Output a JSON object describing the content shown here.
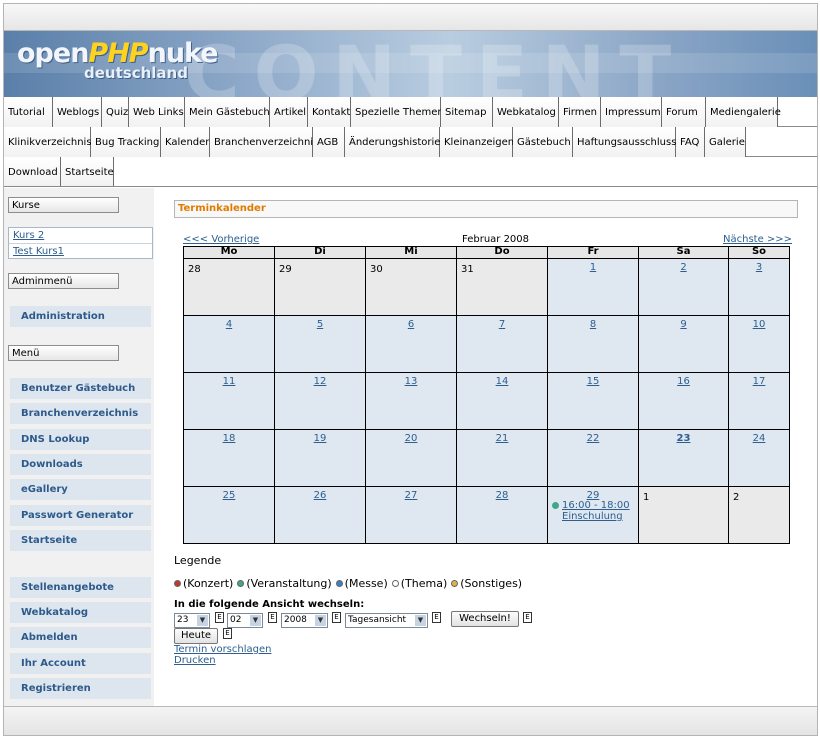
{
  "logo": {
    "part1": "open",
    "part2": "PHP",
    "part3": "nuke",
    "subtitle": "deutschland",
    "watermark": "CONTENT"
  },
  "nav": {
    "row1": [
      "Tutorial",
      "Weblogs",
      "Quiz",
      "Web Links",
      "Mein Gästebuch",
      "Artikel",
      "Kontakt",
      "Spezielle Themen",
      "Sitemap",
      "Webkatalog",
      "Firmen",
      "Impressum",
      "Forum",
      "Mediengalerie"
    ],
    "row2": [
      "Klinikverzeichnis",
      "Bug Tracking",
      "Kalender",
      "Branchenverzeichnis",
      "AGB",
      "Änderungshistorie",
      "Kleinanzeigen",
      "Gästebuch",
      "Haftungsausschluss",
      "FAQ",
      "Galerie"
    ],
    "row3": [
      "Download",
      "Startseite"
    ]
  },
  "sidebar": {
    "kurse_title": "Kurse",
    "kurse": [
      "Kurs 2",
      "Test Kurs1"
    ],
    "admin_title": "Adminmenü",
    "admin_links": [
      "Administration"
    ],
    "menu_title": "Menü",
    "menu_links": [
      "Benutzer Gästebuch",
      "Branchenverzeichnis",
      "DNS Lookup",
      "Downloads",
      "eGallery",
      "Passwort Generator",
      "Startseite"
    ],
    "menu_links2": [
      "Stellenangebote",
      "Webkatalog",
      "Abmelden",
      "Ihr Account",
      "Registrieren"
    ]
  },
  "calendar": {
    "title": "Terminkalender",
    "prev": "<<< Vorherige",
    "month": "Februar 2008",
    "next": "Nächste >>>",
    "weekdays": [
      "Mo",
      "Di",
      "Mi",
      "Do",
      "Fr",
      "Sa",
      "So"
    ],
    "weeks": [
      [
        {
          "d": "28",
          "other": true
        },
        {
          "d": "29",
          "other": true
        },
        {
          "d": "30",
          "other": true
        },
        {
          "d": "31",
          "other": true
        },
        {
          "d": "1"
        },
        {
          "d": "2"
        },
        {
          "d": "3"
        }
      ],
      [
        {
          "d": "4"
        },
        {
          "d": "5"
        },
        {
          "d": "6"
        },
        {
          "d": "7"
        },
        {
          "d": "8"
        },
        {
          "d": "9"
        },
        {
          "d": "10"
        }
      ],
      [
        {
          "d": "11"
        },
        {
          "d": "12"
        },
        {
          "d": "13"
        },
        {
          "d": "14"
        },
        {
          "d": "15"
        },
        {
          "d": "16"
        },
        {
          "d": "17"
        }
      ],
      [
        {
          "d": "18"
        },
        {
          "d": "19"
        },
        {
          "d": "20"
        },
        {
          "d": "21"
        },
        {
          "d": "22"
        },
        {
          "d": "23",
          "today": true
        },
        {
          "d": "24"
        }
      ],
      [
        {
          "d": "25"
        },
        {
          "d": "26"
        },
        {
          "d": "27"
        },
        {
          "d": "28"
        },
        {
          "d": "29",
          "event": {
            "time": "16:00 - 18:00",
            "title": "Einschulung",
            "color": "#3fa88c"
          }
        },
        {
          "d": "1",
          "other": true
        },
        {
          "d": "2",
          "other": true
        }
      ]
    ]
  },
  "legend": {
    "title": "Legende",
    "items": [
      {
        "label": "(Konzert)",
        "color": "#c0392b"
      },
      {
        "label": "(Veranstaltung)",
        "color": "#3fa88c"
      },
      {
        "label": "(Messe)",
        "color": "#3b82c4"
      },
      {
        "label": "(Thema)",
        "color": "#ffffff"
      },
      {
        "label": "(Sonstiges)",
        "color": "#e0b24a"
      }
    ]
  },
  "view_switch": {
    "label": "In die folgende Ansicht wechseln:",
    "day": "23",
    "month": "02",
    "year": "2008",
    "view": "Tagesansicht",
    "submit": "Wechseln!",
    "today": "Heute",
    "suggest": "Termin vorschlagen",
    "print": "Drucken"
  }
}
